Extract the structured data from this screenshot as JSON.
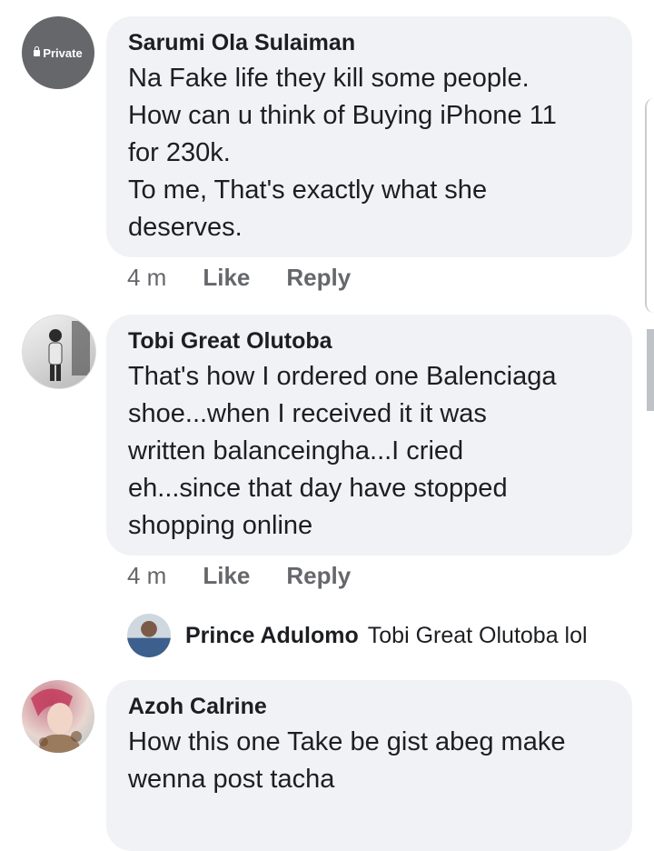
{
  "comments": [
    {
      "avatar_label": "Private",
      "name": "Sarumi Ola Sulaiman",
      "lines": [
        "Na Fake life they kill some people.",
        "How can u think of Buying  iPhone 11",
        "for 230k.",
        "To me, That's exactly what she",
        "deserves."
      ],
      "time": "4 m",
      "like": "Like",
      "reply": "Reply"
    },
    {
      "name": "Tobi Great Olutoba",
      "lines": [
        "That's how I ordered one Balenciaga",
        "shoe...when I received it it was",
        "written balanceingha...I cried",
        "eh...since that day have stopped",
        "shopping online"
      ],
      "time": "4 m",
      "like": "Like",
      "reply": "Reply"
    },
    {
      "name": "Azoh Calrine",
      "lines": [
        "How this one Take be gist abeg make",
        "wenna post tacha"
      ]
    }
  ],
  "reply_preview": {
    "name": "Prince Adulomo",
    "text": "Tobi Great Olutoba lol"
  }
}
